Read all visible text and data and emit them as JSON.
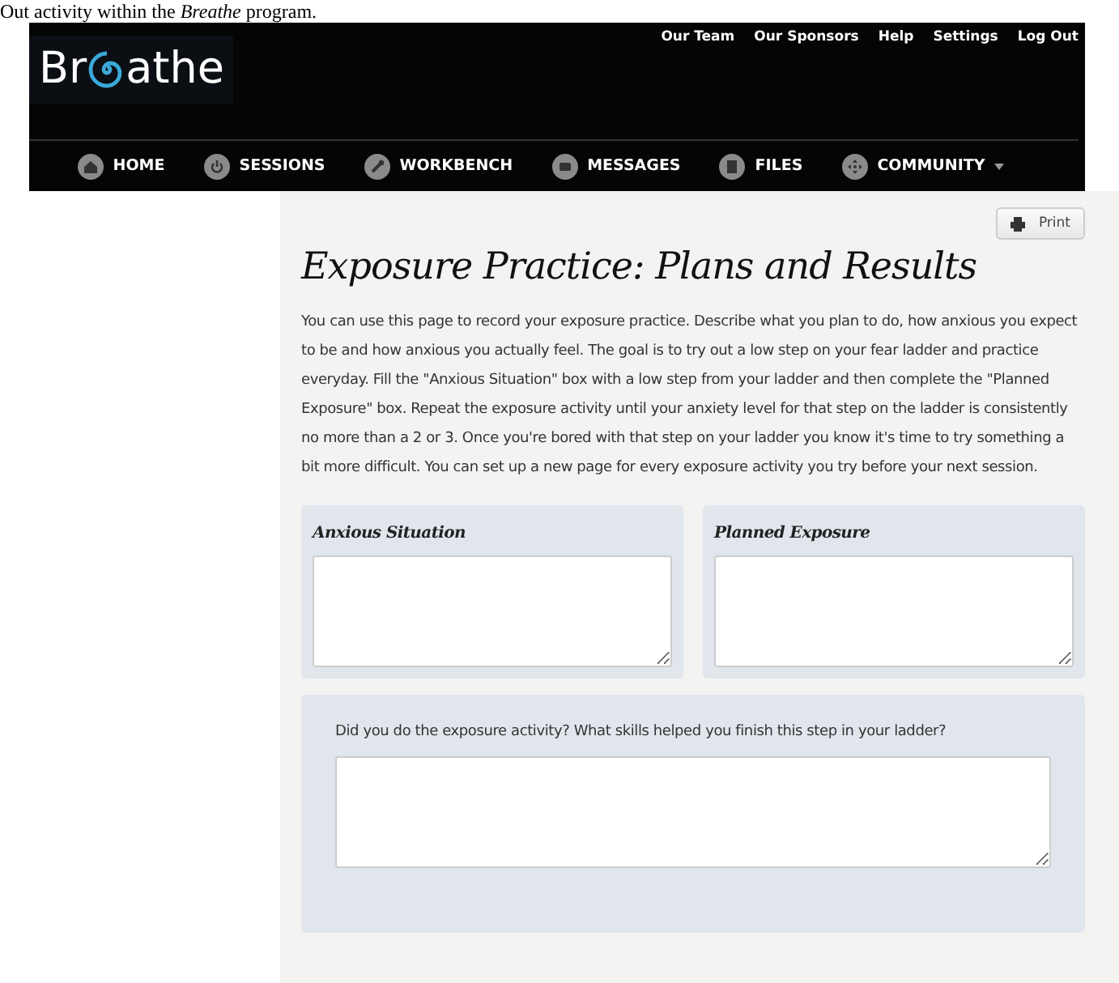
{
  "caption": "Out activity within the *Breathe* program.",
  "logo": {
    "before": "Br",
    "after": "athe"
  },
  "top_links": [
    "Our Team",
    "Our Sponsors",
    "Help",
    "Settings",
    "Log Out"
  ],
  "nav": [
    {
      "label": "HOME",
      "kind": "home"
    },
    {
      "label": "SESSIONS",
      "kind": "power"
    },
    {
      "label": "WORKBENCH",
      "kind": "wrench"
    },
    {
      "label": "MESSAGES",
      "kind": "message"
    },
    {
      "label": "FILES",
      "kind": "file"
    },
    {
      "label": "COMMUNITY",
      "kind": "move",
      "dropdown": true
    }
  ],
  "print_button": "Print",
  "title": "Exposure Practice: Plans and Results",
  "intro": "You can use this page to record your exposure practice. Describe what you plan to do, how anxious you expect to be and how anxious you actually feel. The goal is to try out a low step on your fear ladder and practice everyday. Fill the \"Anxious Situation\" box with a low step from your ladder and then complete the \"Planned Exposure\" box. Repeat the exposure activity until your anxiety level for that step on the ladder is consistently no more than a 2 or 3. Once you're bored with that step on your ladder you know it's time to try something a bit more difficult. You can set up a new page for every exposure activity you try before your next session.",
  "panels": [
    {
      "label": "Anxious Situation"
    },
    {
      "label": "Planned Exposure"
    }
  ],
  "question": {
    "label": "Did you do the exposure activity? What skills helped you finish this step in your ladder?"
  }
}
